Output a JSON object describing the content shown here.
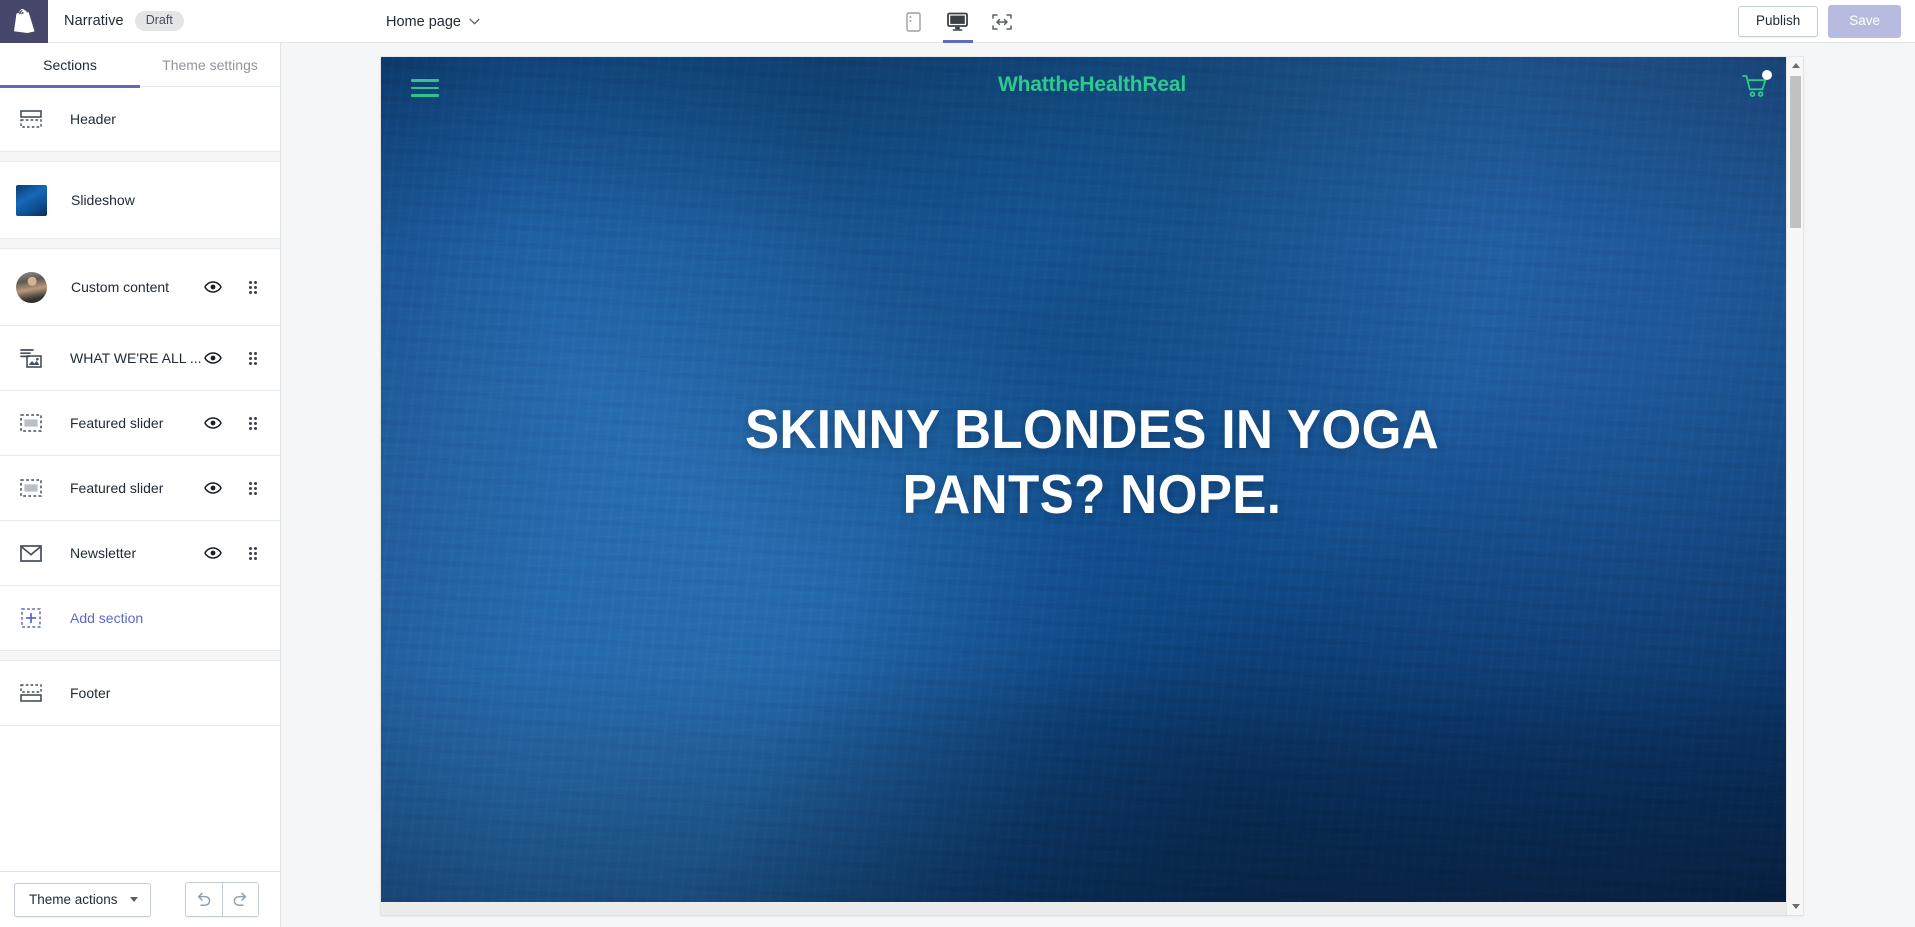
{
  "topbar": {
    "shopify_logo": "shopify-bag-icon",
    "theme_name": "Narrative",
    "status_badge": "Draft",
    "page_selector": "Home page",
    "devices": [
      {
        "name": "mobile",
        "icon": "mobile-icon",
        "active": false
      },
      {
        "name": "desktop",
        "icon": "desktop-icon",
        "active": true
      },
      {
        "name": "full-width",
        "icon": "fullwidth-icon",
        "active": true
      }
    ],
    "publish_label": "Publish",
    "save_label": "Save"
  },
  "sidebar": {
    "tabs": [
      {
        "label": "Sections",
        "active": true
      },
      {
        "label": "Theme settings",
        "active": false
      }
    ],
    "sections": [
      {
        "label": "Header",
        "icon": "header-icon",
        "thumb": null,
        "eye": false,
        "drag": false
      },
      {
        "label": "Slideshow",
        "icon": null,
        "thumb": "image",
        "eye": false,
        "drag": false
      },
      {
        "label": "Custom content",
        "icon": null,
        "thumb": "avatar",
        "eye": true,
        "drag": true
      },
      {
        "label": "WHAT WE'RE ALL ...",
        "icon": "image-text-icon",
        "thumb": null,
        "eye": true,
        "drag": true
      },
      {
        "label": "Featured slider",
        "icon": "slider-icon",
        "thumb": null,
        "eye": true,
        "drag": true
      },
      {
        "label": "Featured slider",
        "icon": "slider-icon",
        "thumb": null,
        "eye": true,
        "drag": true
      },
      {
        "label": "Newsletter",
        "icon": "envelope-icon",
        "thumb": null,
        "eye": true,
        "drag": true
      }
    ],
    "add_section": {
      "label": "Add section",
      "icon": "add-box-icon"
    },
    "footer_section": {
      "label": "Footer",
      "icon": "footer-icon"
    },
    "theme_actions_label": "Theme actions",
    "undo_icon": "undo-icon",
    "redo_icon": "redo-icon"
  },
  "preview": {
    "store_logo_text": "WhattheHealthReal",
    "menu_icon": "hamburger-icon",
    "cart_icon": "shopping-cart-icon",
    "hero_title": "SKINNY BLONDES IN YOGA PANTS? NOPE.",
    "accent_color": "#2ec98d",
    "hero_background_color": "#14599f"
  }
}
